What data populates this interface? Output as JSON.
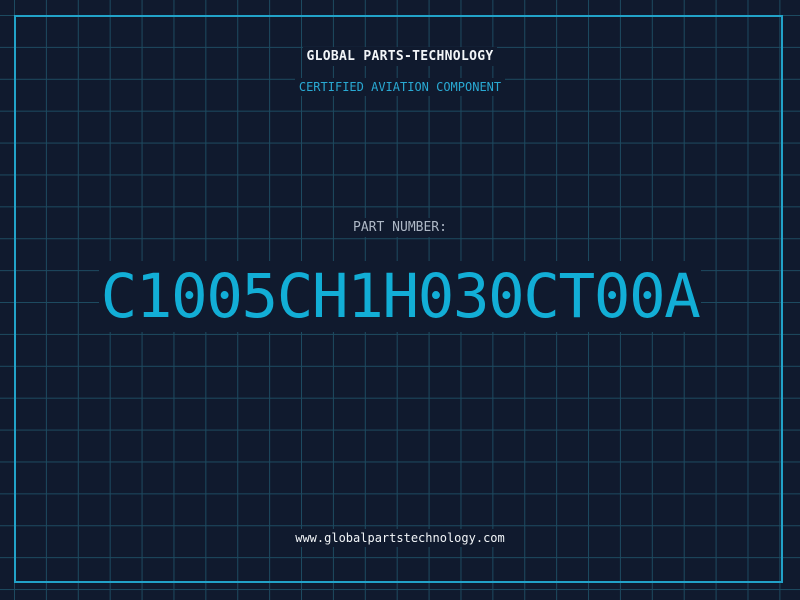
{
  "header": {
    "company_name": "GLOBAL PARTS-TECHNOLOGY",
    "subtitle": "CERTIFIED AVIATION COMPONENT"
  },
  "part": {
    "label": "PART NUMBER:",
    "number": "C1005CH1H030CT00A"
  },
  "footer": {
    "website": "www.globalpartstechnology.com"
  },
  "colors": {
    "background": "#101a2e",
    "grid": "#1d4a60",
    "frame": "#22a2c8",
    "accent": "#12aed6",
    "label": "#aeb8c6",
    "text": "#f2f5f8"
  }
}
